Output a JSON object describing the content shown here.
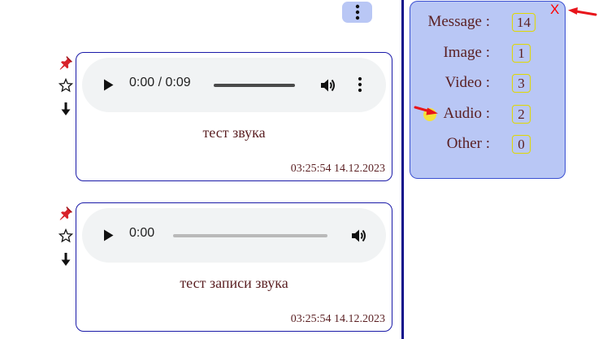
{
  "menu": {
    "icon": "more-vertical-icon"
  },
  "messages": [
    {
      "icons": [
        "pin-icon",
        "star-icon",
        "download-icon"
      ],
      "player": {
        "time": "0:00 / 0:09",
        "progress": 0,
        "has_more_button": true
      },
      "caption": "тест звука",
      "timestamp": "03:25:54 14.12.2023"
    },
    {
      "icons": [
        "pin-icon",
        "star-icon",
        "download-icon"
      ],
      "player": {
        "time": "0:00",
        "progress": 0,
        "has_more_button": false
      },
      "caption": "тест записи звука",
      "timestamp": "03:25:54 14.12.2023"
    }
  ],
  "stats": {
    "close_label": "X",
    "items": [
      {
        "label": "Message :",
        "count": "14"
      },
      {
        "label": "Image :",
        "count": "1"
      },
      {
        "label": "Video :",
        "count": "3"
      },
      {
        "label": "Audio :",
        "count": "2"
      },
      {
        "label": "Other :",
        "count": "0"
      }
    ]
  },
  "colors": {
    "accent_panel": "#b9c7f5",
    "border_blue": "#1a1aa8",
    "text_maroon": "#5a1f22",
    "count_border": "#e0d800",
    "close_red": "#ff0000",
    "arrow_red": "#e8141b",
    "cursor_yellow": "#f4e13a"
  }
}
